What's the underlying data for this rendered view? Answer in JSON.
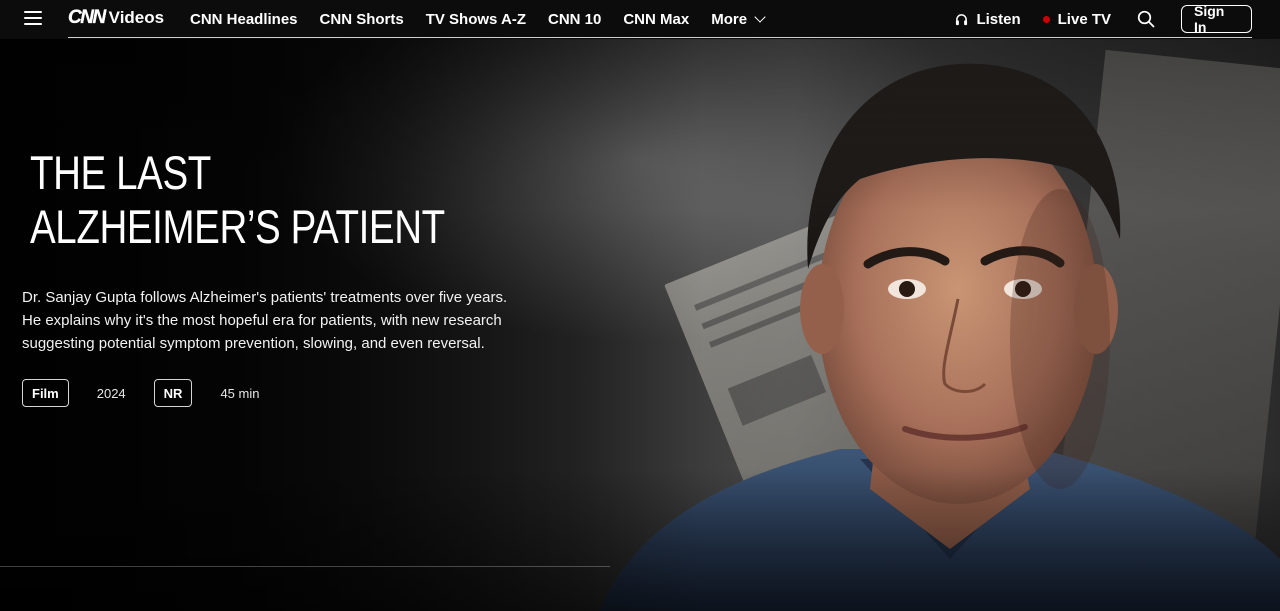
{
  "nav": {
    "logo_mark": "CNN",
    "logo_text": "Videos",
    "links": [
      "CNN Headlines",
      "CNN Shorts",
      "TV Shows A-Z",
      "CNN 10",
      "CNN Max",
      "More"
    ],
    "listen_label": "Listen",
    "live_label": "Live TV",
    "signin_label": "Sign In",
    "icons": [
      "hamburger-menu-icon",
      "headphones-icon",
      "live-dot-icon",
      "search-icon",
      "chevron-down-icon"
    ]
  },
  "hero": {
    "title_line1": "The Last",
    "title_line2": "Alzheimer’s Patient",
    "description": "Dr. Sanjay Gupta follows Alzheimer's patients' treatments over five years. He explains why it's the most hopeful era for patients, with new research suggesting potential symptom prevention, slowing, and even reversal.",
    "type_badge": "Film",
    "year": "2024",
    "rating_badge": "NR",
    "duration": "45 min"
  },
  "colors": {
    "background": "#0c0c0c",
    "live_dot": "#cc0000",
    "text": "#ffffff"
  }
}
